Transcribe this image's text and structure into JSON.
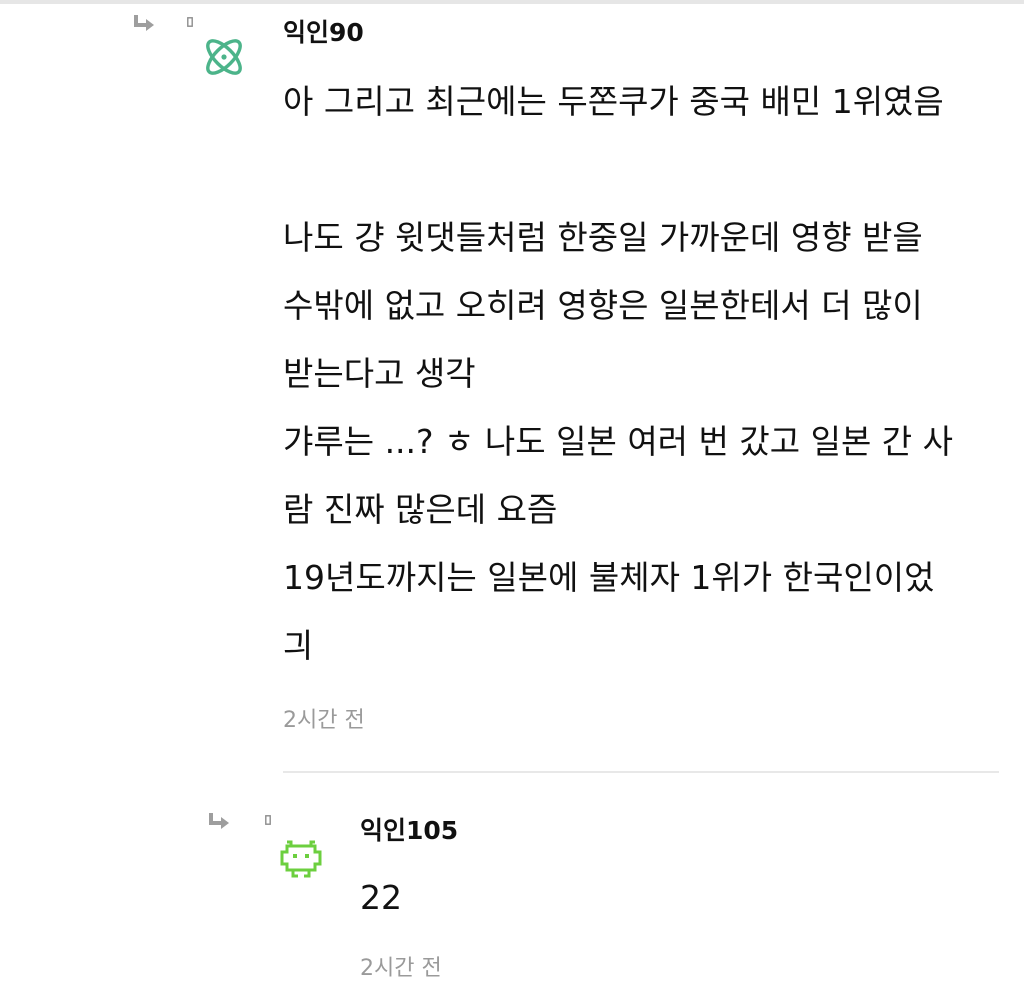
{
  "comments": [
    {
      "nickname": "익인90",
      "avatar_icon": "atom-icon",
      "avatar_color": "#4cb48a",
      "lines": [
        "아 그리고 최근에는 두쫀쿠가 중국 배민 1위였음",
        "",
        "나도 걍 윗댓들처럼 한중일 가까운데 영향 받을",
        "수밖에 없고 오히려 영향은 일본한테서 더 많이",
        "받는다고 생각",
        "갸루는 ...? ㅎ 나도 일본 여러 번 갔고 일본 간 사",
        "람 진짜 많은데 요즘",
        "19년도까지는 일본에 불체자 1위가 한국인이었",
        "긔"
      ],
      "time": "2시간 전"
    },
    {
      "nickname": "익인105",
      "avatar_icon": "space-invader-icon",
      "avatar_color": "#6ccf3f",
      "lines": [
        "22"
      ],
      "time": "2시간 전"
    }
  ],
  "colors": {
    "text": "#111111",
    "muted": "#9a9a9a",
    "divider": "#e8e8e8"
  },
  "icons": {
    "reply": "reply-arrow-icon"
  }
}
